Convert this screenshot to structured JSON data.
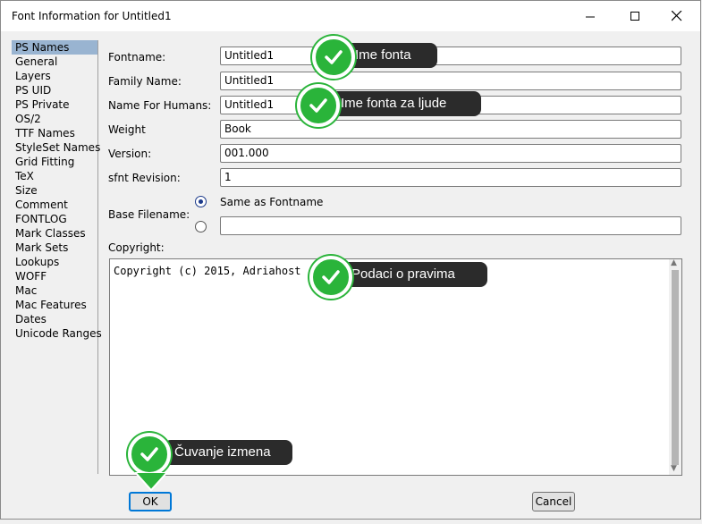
{
  "window": {
    "title": "Font Information for Untitled1"
  },
  "sidebar": {
    "items": [
      "PS Names",
      "General",
      "Layers",
      "PS UID",
      "PS Private",
      "OS/2",
      "TTF Names",
      "StyleSet Names",
      "Grid Fitting",
      "TeX",
      "Size",
      "Comment",
      "FONTLOG",
      "Mark Classes",
      "Mark Sets",
      "Lookups",
      "WOFF",
      "Mac",
      "Mac Features",
      "Dates",
      "Unicode Ranges"
    ],
    "selected": "PS Names"
  },
  "form": {
    "fontname_label": "Fontname:",
    "fontname_value": "Untitled1",
    "family_label": "Family Name:",
    "family_value": "Untitled1",
    "humans_label": "Name For Humans:",
    "humans_value": "Untitled1",
    "weight_label": "Weight",
    "weight_value": "Book",
    "version_label": "Version:",
    "version_value": "001.000",
    "sfnt_label": "sfnt Revision:",
    "sfnt_value": "1",
    "base_label": "Base Filename:",
    "same_as_label": "Same as Fontname",
    "base_custom_value": "",
    "copyright_label": "Copyright:",
    "copyright_value": "Copyright (c) 2015, Adriahost"
  },
  "buttons": {
    "ok": "OK",
    "cancel": "Cancel"
  },
  "callouts": {
    "fontname": "Ime fonta",
    "humans": "Ime fonta za ljude",
    "copyright": "Podaci o pravima",
    "save": "Čuvanje izmena"
  },
  "colors": {
    "selection": "#99b4d1",
    "callout_bg": "#2b2b2b",
    "check_green": "#2ab43a"
  }
}
